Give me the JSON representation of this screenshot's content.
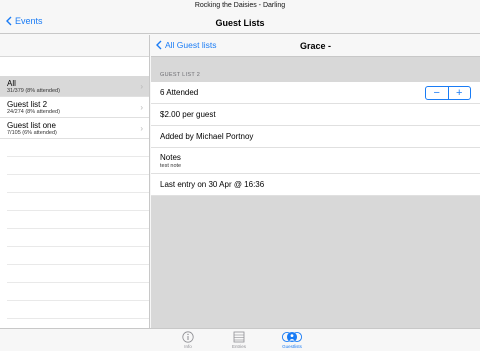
{
  "status_bar": {
    "title": "Rocking the Daisies - Darling"
  },
  "nav": {
    "back_label": "Events",
    "title": "Guest Lists"
  },
  "master": {
    "items": [
      {
        "title": "All",
        "subtitle": "31/379 (8% attended)",
        "selected": true
      },
      {
        "title": "Guest list 2",
        "subtitle": "24/274 (8% attended)",
        "selected": false
      },
      {
        "title": "Guest list one",
        "subtitle": "7/105 (6% attended)",
        "selected": false
      }
    ]
  },
  "detail": {
    "back_label": "All Guest lists",
    "title": "Grace -",
    "section_header": "GUEST LIST 2",
    "attended": "6 Attended",
    "stepper": {
      "minus": "−",
      "plus": "+"
    },
    "price": "$2.00 per guest",
    "added_by": "Added by Michael Portnoy",
    "notes_label": "Notes",
    "notes_value": "test note",
    "last_entry": "Last entry on 30 Apr @ 16:36"
  },
  "tabs": [
    {
      "label": "Info",
      "icon": "info-icon",
      "active": false
    },
    {
      "label": "Entries",
      "icon": "list-icon",
      "active": false
    },
    {
      "label": "Guestlists",
      "icon": "people-icon",
      "active": true
    }
  ],
  "colors": {
    "accent": "#1a7cf5",
    "selected_row": "#d9d9d9",
    "background": "#d8d8d8"
  }
}
